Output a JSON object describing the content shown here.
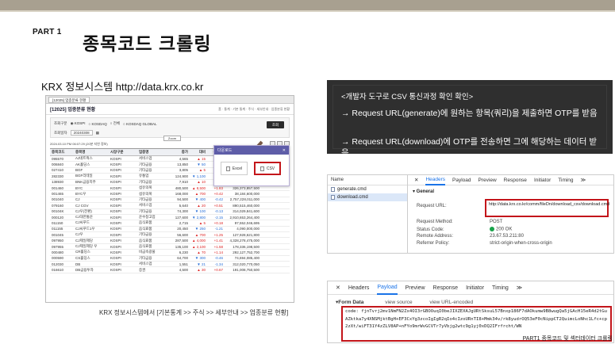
{
  "header": {
    "part": "PART 1",
    "title": "종목코드 크롤링"
  },
  "krx": {
    "label": "KRX 정보시스템  http://data.krx.co.kr",
    "caption": "KRX 정보시스템에서 [기본통계 >> 주식 >> 세부안내 >> 업종분류 현황]",
    "screenshot": {
      "tab": "[12025] 업종분류 현황",
      "heading": "[12025] 업종분류 현황",
      "breadcrumb": "홈 · 통계 · 기본 통계 · 주식 · 세부안내 · 업종분류 현황",
      "market_label": "조회구분",
      "market_options": [
        "KOSPI",
        "KOSDAQ",
        "전체",
        "KOSDAQ GLOBAL"
      ],
      "date_label": "조회일자",
      "date_value": "20240308",
      "search_button": "조회",
      "zoom": "Zoom",
      "timestamp": "2024.03.10 PM 06:07:29 (20분 지연 정보)",
      "columns": [
        "종목코드",
        "종목명",
        "시장구분",
        "업종명",
        "종가",
        "대비",
        "등락률",
        "시가총액",
        "외국인"
      ],
      "rows": [
        [
          "095570",
          "AJ네트웍스",
          "KOSPI",
          "서비스업",
          "4,565",
          "▲ 15",
          "+0.33",
          "206,571,011,500",
          ""
        ],
        [
          "006840",
          "AK홀딩스",
          "KOSPI",
          "기타금융",
          "13,850",
          "▼ 50",
          "-0.36",
          "183,478,000,000",
          ""
        ],
        [
          "027410",
          "BGF",
          "KOSPI",
          "기타금융",
          "3,805",
          "▲ 5",
          "+0.13",
          "362,207,617,130",
          ""
        ],
        [
          "282330",
          "BGF리테일",
          "KOSPI",
          "유통업",
          "124,900",
          "▼ 1,100",
          "-0.87",
          "2,158,775,013,100",
          ""
        ],
        [
          "138930",
          "BNK금융지주",
          "KOSPI",
          "기타금융",
          "7,910",
          "▲ 10",
          "+0.13",
          "2,547,719,544,580",
          ""
        ],
        [
          "001460",
          "BYC",
          "KOSPI",
          "섬유의복",
          "480,500",
          "▲ 8,500",
          "+1.83",
          "326,373,857,500",
          ""
        ],
        [
          "001465",
          "BYC우",
          "KOSPI",
          "섬유의복",
          "168,000",
          "▲ 700",
          "+0.42",
          "38,184,600,000",
          ""
        ],
        [
          "001040",
          "CJ",
          "KOSPI",
          "기타금융",
          "94,500",
          "▼ 400",
          "-0.42",
          "2,757,228,011,000",
          ""
        ],
        [
          "079160",
          "CJ CGV",
          "KOSPI",
          "서비스업",
          "5,640",
          "▲ 20",
          "+0.51",
          "890,515,460,000",
          ""
        ],
        [
          "00104K",
          "CJ우(전환)",
          "KOSPI",
          "기타금융",
          "74,300",
          "▼ 100",
          "-0.13",
          "314,029,841,600",
          ""
        ],
        [
          "000120",
          "CJ대한통운",
          "KOSPI",
          "운수창고업",
          "127,600",
          "▼ 2,800",
          "-2.15",
          "2,910,653,264,400",
          ""
        ],
        [
          "011150",
          "CJ씨푸드",
          "KOSPI",
          "음식료품",
          "2,715",
          "▲ 5",
          "+0.18",
          "97,552,046,695",
          ""
        ],
        [
          "011155",
          "CJ씨푸드1우",
          "KOSPI",
          "음식료품",
          "20,450",
          "▼ 250",
          "-1.21",
          "4,090,000,000",
          ""
        ],
        [
          "001045",
          "CJ우",
          "KOSPI",
          "기타금융",
          "56,600",
          "▲ 700",
          "+1.25",
          "127,928,621,800",
          ""
        ],
        [
          "097950",
          "CJ제일제당",
          "KOSPI",
          "음식료품",
          "287,500",
          "▲ 4,000",
          "+1.41",
          "4,328,278,475,000",
          ""
        ],
        [
          "097955",
          "CJ제일제당 우",
          "KOSPI",
          "음식료품",
          "135,100",
          "▲ 2,100",
          "+1.58",
          "178,336,198,500",
          ""
        ],
        [
          "000480",
          "CR홀딩스",
          "KOSPI",
          "비금속광물",
          "6,230",
          "▲ 70",
          "+1.14",
          "292,127,752,700",
          ""
        ],
        [
          "000590",
          "CS홀딩스",
          "KOSPI",
          "기타금융",
          "64,700",
          "▼ 300",
          "-0.46",
          "74,694,085,400",
          ""
        ],
        [
          "012030",
          "DB",
          "KOSPI",
          "서비스업",
          "1,551",
          "▼ 21",
          "-1.34",
          "312,020,770,050",
          ""
        ],
        [
          "016610",
          "DB금융투자",
          "KOSPI",
          "증권",
          "4,500",
          "▲ 30",
          "+0.67",
          "191,008,750,500",
          ""
        ]
      ],
      "popup": {
        "title": "다운로드",
        "close": "✕",
        "excel": "Excel",
        "csv": "CSV"
      }
    }
  },
  "board": {
    "heading": "<개발자 도구로 CSV 통신과정 확인 확인>",
    "line1": "→ Request URL(generate)에 원하는 항목(쿼리)을 제출하면 OTP를 받음",
    "line2": "→ Request URL(download)에 OTP를 전송하면 그에 해당하는 데이터 받음"
  },
  "devtools1": {
    "name_header": "Name",
    "files": [
      "generate.cmd",
      "download.cmd"
    ],
    "tabs": [
      "✕",
      "Headers",
      "Payload",
      "Preview",
      "Response",
      "Initiator",
      "Timing",
      "≫"
    ],
    "section": "▾ General",
    "request_url_label": "Request URL:",
    "request_url_value": "http://data.krx.co.kr/comm/fileDn/download_csv/download.cmd",
    "rows": [
      {
        "k": "Request Method:",
        "v": "POST"
      },
      {
        "k": "Status Code:",
        "v": "200 OK"
      },
      {
        "k": "Remote Address:",
        "v": "23.67.53.211:80"
      },
      {
        "k": "Referrer Policy:",
        "v": "strict-origin-when-cross-origin"
      }
    ]
  },
  "devtools2": {
    "tabs": [
      "✕",
      "Headers",
      "Payload",
      "Preview",
      "Response",
      "Initiator",
      "Timing",
      "≫"
    ],
    "form_data": "▾Form Data",
    "view_source": "view source",
    "view_url": "view URL-encoded",
    "code": "code: fjnTvrj2mv1NmFN2Zx4OI3rGBOOuqI0beJIXZEXAJgURtSksuL57Bnxp186F7dAOkumw9B8wugQa5jGAcH15eR4d2tGuAZktka7y4XNSMjktBgH+EF3CxYg3zcoIgIgR2qIo4cIzoURnTI8+Mmk34v/rk8yudrOQ53eF0cNippCT2QuimcLoNhc1Lfc+cp2zXt/wiFT31Y4zZLV8AP+nFYo9mrWvGCVTr7yVbjg2wtc9g1yj0xDQ2IFrfrcht/WN"
  },
  "footer": "PART1 종목코드 및 섹터데이터 크롤링"
}
